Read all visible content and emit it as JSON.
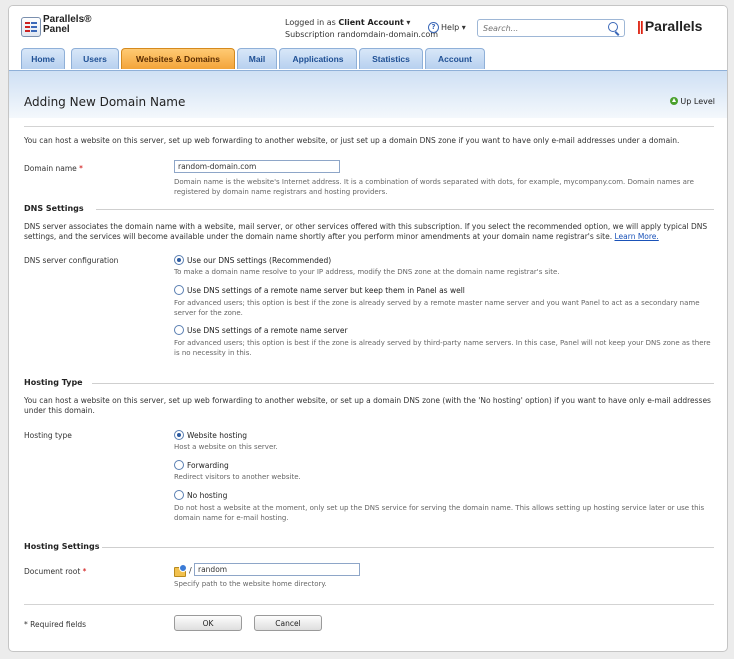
{
  "header": {
    "logo_line1": "Parallels®",
    "logo_line2": "Panel",
    "logged_in_prefix": "Logged in as ",
    "account_name": "Client Account",
    "account_caret": "▾",
    "subscription": "Subscription randomdain-domain.com",
    "help_label": "Help ▾",
    "search_placeholder": "Search...",
    "brand": "Parallels"
  },
  "tabs": [
    {
      "label": "Home",
      "active": false
    },
    {
      "label": "Users",
      "active": false
    },
    {
      "label": "Websites & Domains",
      "active": true
    },
    {
      "label": "Mail",
      "active": false
    },
    {
      "label": "Applications",
      "active": false
    },
    {
      "label": "Statistics",
      "active": false
    },
    {
      "label": "Account",
      "active": false
    }
  ],
  "page": {
    "title": "Adding New Domain Name",
    "up_level": "Up Level",
    "intro": "You can host a website on this server, set up web forwarding to another website, or just set up a domain DNS zone if you want to have only e-mail addresses under a domain."
  },
  "domain": {
    "label": "Domain name",
    "required_mark": "*",
    "value": "random-domain.com",
    "hint": "Domain name is the website's Internet address. It is a combination of words separated with dots, for example, mycompany.com. Domain names are registered by domain name registrars and hosting providers."
  },
  "dns": {
    "section": "DNS Settings",
    "desc": "DNS server associates the domain name with a website, mail server, or other services offered with this subscription. If you select the recommended option, we will apply typical DNS settings, and the services will become available under the domain name shortly after you perform minor amendments at your domain name registrar's site.",
    "learn_more": "Learn More.",
    "label": "DNS server configuration",
    "options": [
      {
        "label": "Use our DNS settings (Recommended)",
        "hint": "To make a domain name resolve to your IP address, modify the DNS zone at the domain name registrar's site.",
        "selected": true
      },
      {
        "label": "Use DNS settings of a remote name server but keep them in Panel as well",
        "hint": "For advanced users; this option is best if the zone is already served by a remote master name server and you want Panel to act as a secondary name server for the zone.",
        "selected": false
      },
      {
        "label": "Use DNS settings of a remote name server",
        "hint": "For advanced users; this option is best if the zone is already served by third-party name servers. In this case, Panel will not keep your DNS zone as there is no necessity in this.",
        "selected": false
      }
    ]
  },
  "hosting_type": {
    "section": "Hosting Type",
    "desc": "You can host a website on this server, set up web forwarding to another website, or set up a domain DNS zone (with the 'No hosting' option) if you want to have only e-mail addresses under this domain.",
    "label": "Hosting type",
    "options": [
      {
        "label": "Website hosting",
        "hint": "Host a website on this server.",
        "selected": true
      },
      {
        "label": "Forwarding",
        "hint": "Redirect visitors to another website.",
        "selected": false
      },
      {
        "label": "No hosting",
        "hint": "Do not host a website at the moment, only set up the DNS service for serving the domain name. This allows setting up hosting service later or use this domain name for e-mail hosting.",
        "selected": false
      }
    ]
  },
  "hosting_settings": {
    "section": "Hosting Settings",
    "doc_root_label": "Document root",
    "required_mark": "*",
    "slash": "/",
    "doc_root_value": "random",
    "hint": "Specify path to the website home directory."
  },
  "footer": {
    "required_note": "* Required fields",
    "ok": "OK",
    "cancel": "Cancel"
  },
  "colors": {
    "accent_blue": "#1e4f94",
    "active_tab": "#f3a43a",
    "required": "#cc0000",
    "brand_red": "#dd2211"
  }
}
